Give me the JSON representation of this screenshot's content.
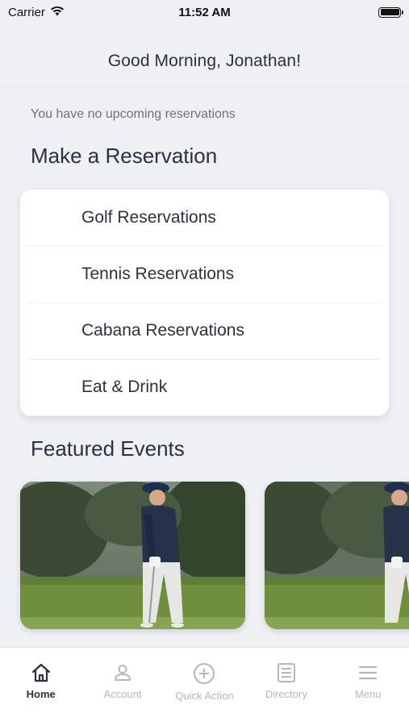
{
  "status": {
    "carrier": "Carrier",
    "time": "11:52 AM"
  },
  "header": {
    "title": "Good Morning, Jonathan!"
  },
  "reservations": {
    "empty_text": "You have no upcoming reservations"
  },
  "make_reservation": {
    "title": "Make a Reservation",
    "items": [
      {
        "label": "Golf Reservations"
      },
      {
        "label": "Tennis Reservations"
      },
      {
        "label": "Cabana Reservations"
      },
      {
        "label": "Eat & Drink"
      }
    ]
  },
  "featured": {
    "title": "Featured Events"
  },
  "tabs": [
    {
      "label": "Home",
      "icon": "home-icon",
      "active": true
    },
    {
      "label": "Account",
      "icon": "account-icon"
    },
    {
      "label": "Quick Action",
      "icon": "plus-circle-icon"
    },
    {
      "label": "Directory",
      "icon": "directory-icon"
    },
    {
      "label": "Menu",
      "icon": "menu-icon"
    }
  ],
  "colors": {
    "background": "#eef0f4",
    "text": "#2b3142",
    "inactive_tab": "#b4b7be"
  }
}
